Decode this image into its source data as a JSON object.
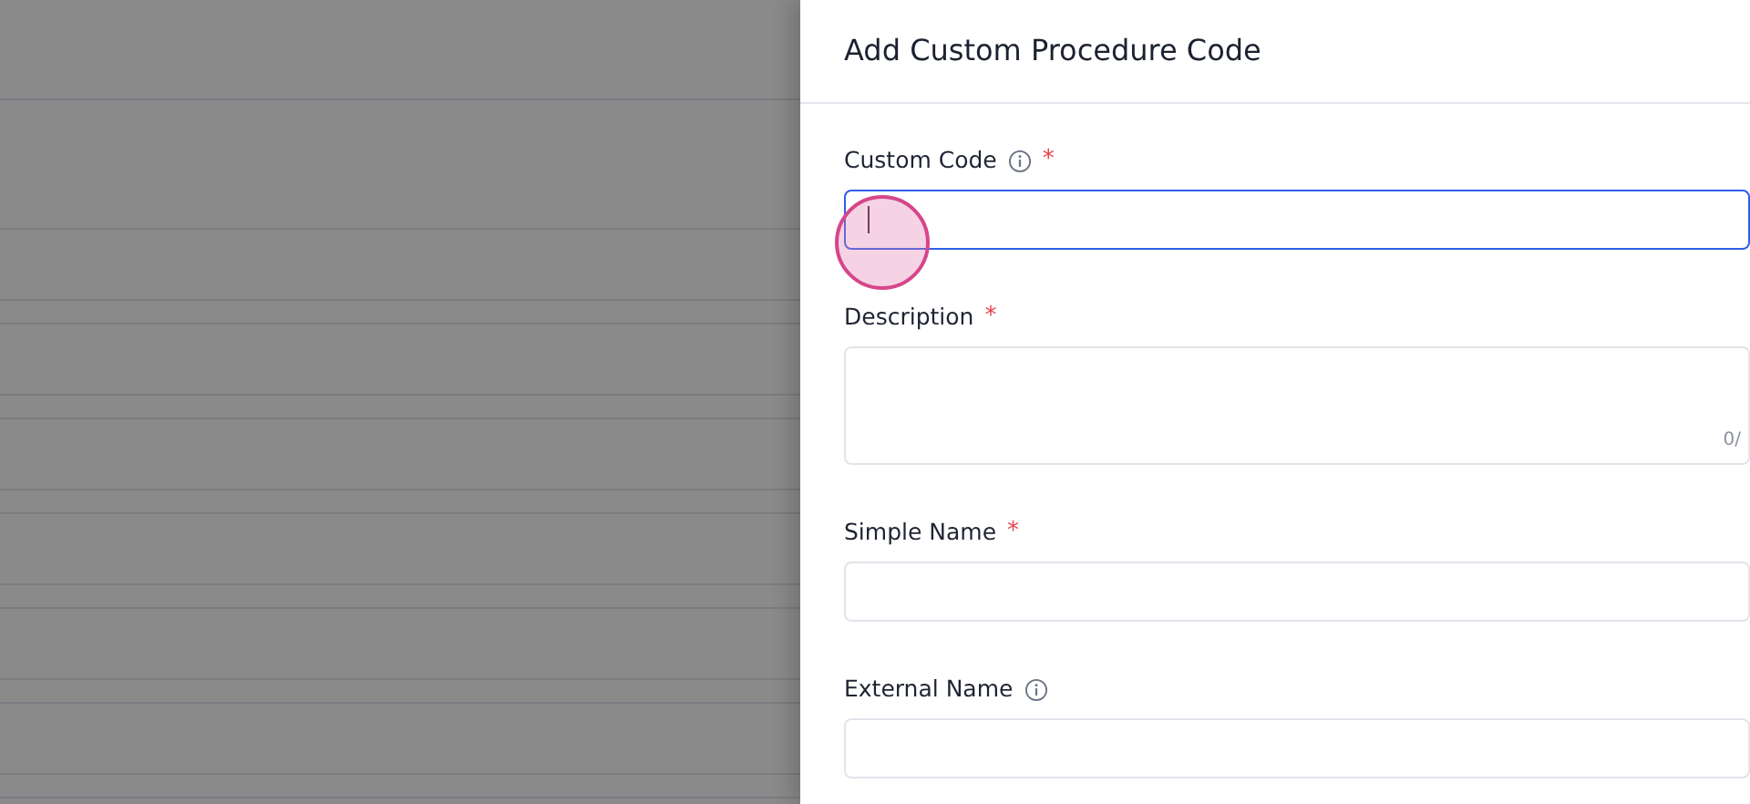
{
  "drawer": {
    "title": "Add Custom Procedure Code"
  },
  "fields": [
    {
      "kind": "input",
      "label": "Custom Code",
      "info": true,
      "required_mark": "*",
      "focused": true
    },
    {
      "kind": "textarea",
      "label": "Description",
      "info": false,
      "required_mark": "*",
      "focused": false,
      "counter": "0/"
    },
    {
      "kind": "input",
      "label": "Simple Name",
      "info": false,
      "required_mark": "*",
      "focused": false
    },
    {
      "kind": "input",
      "label": "External Name",
      "info": true,
      "focused": false
    }
  ]
}
